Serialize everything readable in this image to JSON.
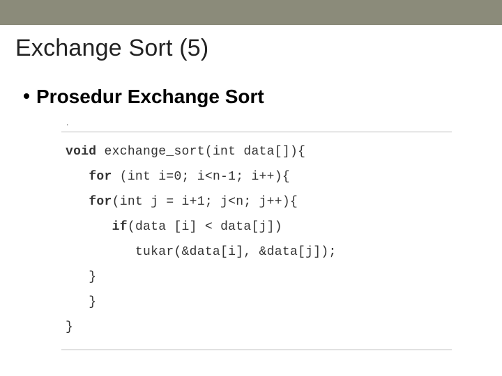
{
  "title": "Exchange Sort (5)",
  "subtitle": "Prosedur Exchange Sort",
  "tiny_bullet": ".",
  "code": {
    "l1_kw": "void",
    "l1_rest": " exchange_sort(int data[]){",
    "l2_pad": "   ",
    "l2_kw": "for",
    "l2_rest": " (int i=0; i<n-1; i++){",
    "l3_pad": "   ",
    "l3_kw": "for",
    "l3_rest": "(int j = i+1; j<n; j++){",
    "l4_pad": "      ",
    "l4_kw": "if",
    "l4_rest": "(data [i] < data[j])",
    "l5": "         tukar(&data[i], &data[j]);",
    "l6": "   }",
    "l7": "   }",
    "l8": "}"
  }
}
